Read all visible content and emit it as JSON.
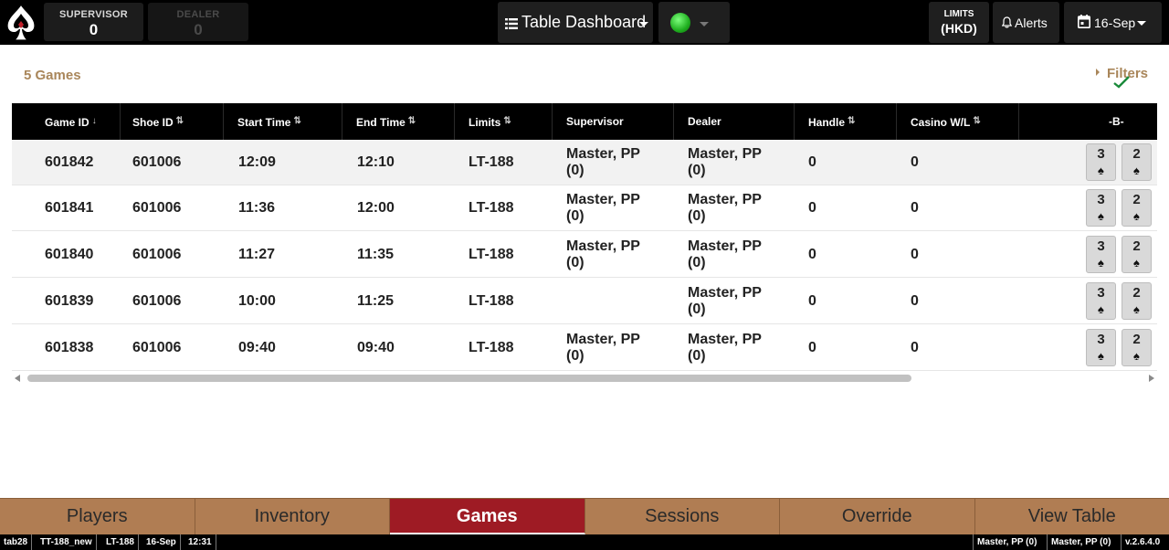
{
  "topbar": {
    "supervisor_label": "SUPERVISOR",
    "supervisor_value": "0",
    "dealer_label": "DEALER",
    "dealer_value": "0",
    "dashboard_label": "Table Dashboard",
    "status_color": "#1fae1f",
    "limits_line1": "LIMITS",
    "limits_line2": "(HKD)",
    "alerts_label": "Alerts",
    "date_label": "16-Sep"
  },
  "main": {
    "games_count": "5 Games",
    "filters_label": "Filters"
  },
  "table": {
    "headers": {
      "game_id": "Game ID",
      "shoe_id": "Shoe ID",
      "start_time": "Start Time",
      "end_time": "End Time",
      "limits": "Limits",
      "supervisor": "Supervisor",
      "dealer": "Dealer",
      "handle": "Handle",
      "casino_wl": "Casino W/L",
      "b": "-B-"
    },
    "rows": [
      {
        "game_id": "601842",
        "shoe_id": "601006",
        "start": "12:09",
        "end": "12:10",
        "limits": "LT-188",
        "sup1": "Master, PP",
        "sup2": "(0)",
        "dealer1": "Master, PP",
        "dealer2": "(0)",
        "handle": "0",
        "wl": "0",
        "card1_rank": "3",
        "card1_suit": "♠",
        "card2_rank": "2",
        "card2_suit": "♠"
      },
      {
        "game_id": "601841",
        "shoe_id": "601006",
        "start": "11:36",
        "end": "12:00",
        "limits": "LT-188",
        "sup1": "Master, PP",
        "sup2": "(0)",
        "dealer1": "Master, PP",
        "dealer2": "(0)",
        "handle": "0",
        "wl": "0",
        "card1_rank": "3",
        "card1_suit": "♠",
        "card2_rank": "2",
        "card2_suit": "♠"
      },
      {
        "game_id": "601840",
        "shoe_id": "601006",
        "start": "11:27",
        "end": "11:35",
        "limits": "LT-188",
        "sup1": "Master, PP",
        "sup2": "(0)",
        "dealer1": "Master, PP",
        "dealer2": "(0)",
        "handle": "0",
        "wl": "0",
        "card1_rank": "3",
        "card1_suit": "♠",
        "card2_rank": "2",
        "card2_suit": "♠"
      },
      {
        "game_id": "601839",
        "shoe_id": "601006",
        "start": "10:00",
        "end": "11:25",
        "limits": "LT-188",
        "sup1": "",
        "sup2": "",
        "dealer1": "Master, PP",
        "dealer2": "(0)",
        "handle": "0",
        "wl": "0",
        "card1_rank": "3",
        "card1_suit": "♠",
        "card2_rank": "2",
        "card2_suit": "♠"
      },
      {
        "game_id": "601838",
        "shoe_id": "601006",
        "start": "09:40",
        "end": "09:40",
        "limits": "LT-188",
        "sup1": "Master, PP",
        "sup2": "(0)",
        "dealer1": "Master, PP",
        "dealer2": "(0)",
        "handle": "0",
        "wl": "0",
        "card1_rank": "3",
        "card1_suit": "♠",
        "card2_rank": "2",
        "card2_suit": "♠"
      }
    ]
  },
  "tabs": [
    {
      "label": "Players"
    },
    {
      "label": "Inventory"
    },
    {
      "label": "Games",
      "active": true
    },
    {
      "label": "Sessions"
    },
    {
      "label": "Override"
    },
    {
      "label": "View Table"
    }
  ],
  "statusbar": {
    "left": [
      "tab28",
      "TT-188_new",
      "LT-188",
      "16-Sep",
      "12:31"
    ],
    "right": [
      "Master, PP (0)",
      "Master, PP (0)",
      "v.2.6.4.0"
    ]
  },
  "icons": {
    "logo": "spade-logo-icon",
    "dashboard": "list-icon",
    "status": "status-dot-icon",
    "alerts": "bell-icon",
    "date": "calendar-icon",
    "filters_check": "check-icon",
    "card_suit": "spade-icon"
  }
}
